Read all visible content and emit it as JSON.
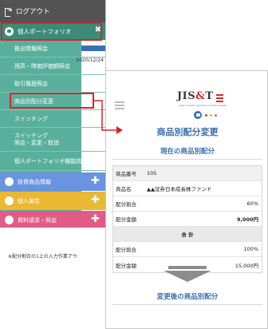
{
  "menu": {
    "logout_label": "ログアウト",
    "portfolio_label": "個人ポートフォリオ",
    "portfolio_close": "✖",
    "sub_items": [
      "拠出情報照会",
      "残高・時価評価額照会",
      "取引履歴照会",
      "商品別配分変更",
      "スイッチング"
    ],
    "sub_item_two_line": [
      "スイッチング",
      "照会・変更・取消"
    ],
    "sub_item_desc": "個人ポートフォリオ機能説明",
    "categories": [
      {
        "label": "投資商品情報",
        "plus": "✚"
      },
      {
        "label": "個人属性",
        "plus": "✚"
      },
      {
        "label": "資料請求・照会",
        "plus": "✚"
      }
    ],
    "background_date": "2020/12/24"
  },
  "detail": {
    "logo_text_1": "JIS",
    "logo_amp": "&",
    "logo_text_2": "T",
    "logo_sub": "Japan Investor Solutions & Technologies",
    "screen_title": "商品別配分変更",
    "current_section_title": "現在の商品別配分",
    "product_number_label": "商品番号",
    "product_number_value": "105",
    "product_name_label": "商品名",
    "product_name_value": "▲▲証券日本成長株ファンド",
    "alloc_ratio_label": "配分割合",
    "alloc_ratio_value": "60%",
    "alloc_amount_label": "配分金額",
    "alloc_amount_value": "9,000円",
    "total_label": "合 計",
    "total_ratio_label": "配分割合",
    "total_ratio_value": "100%",
    "total_amount_label": "配分金額",
    "total_amount_value": "15,000円",
    "after_section_title": "変更後の商品別配分",
    "note": "※配分割合の1上の入力作業アウ"
  },
  "colors": {
    "menu_green": "#58b09c",
    "menu_dark_green": "#3c8a78",
    "highlight_red": "#d5262a",
    "accent_blue": "#3a6fae",
    "cat_blue": "#6a93e0",
    "cat_yellow": "#e9b934",
    "cat_pink": "#e25b86"
  }
}
